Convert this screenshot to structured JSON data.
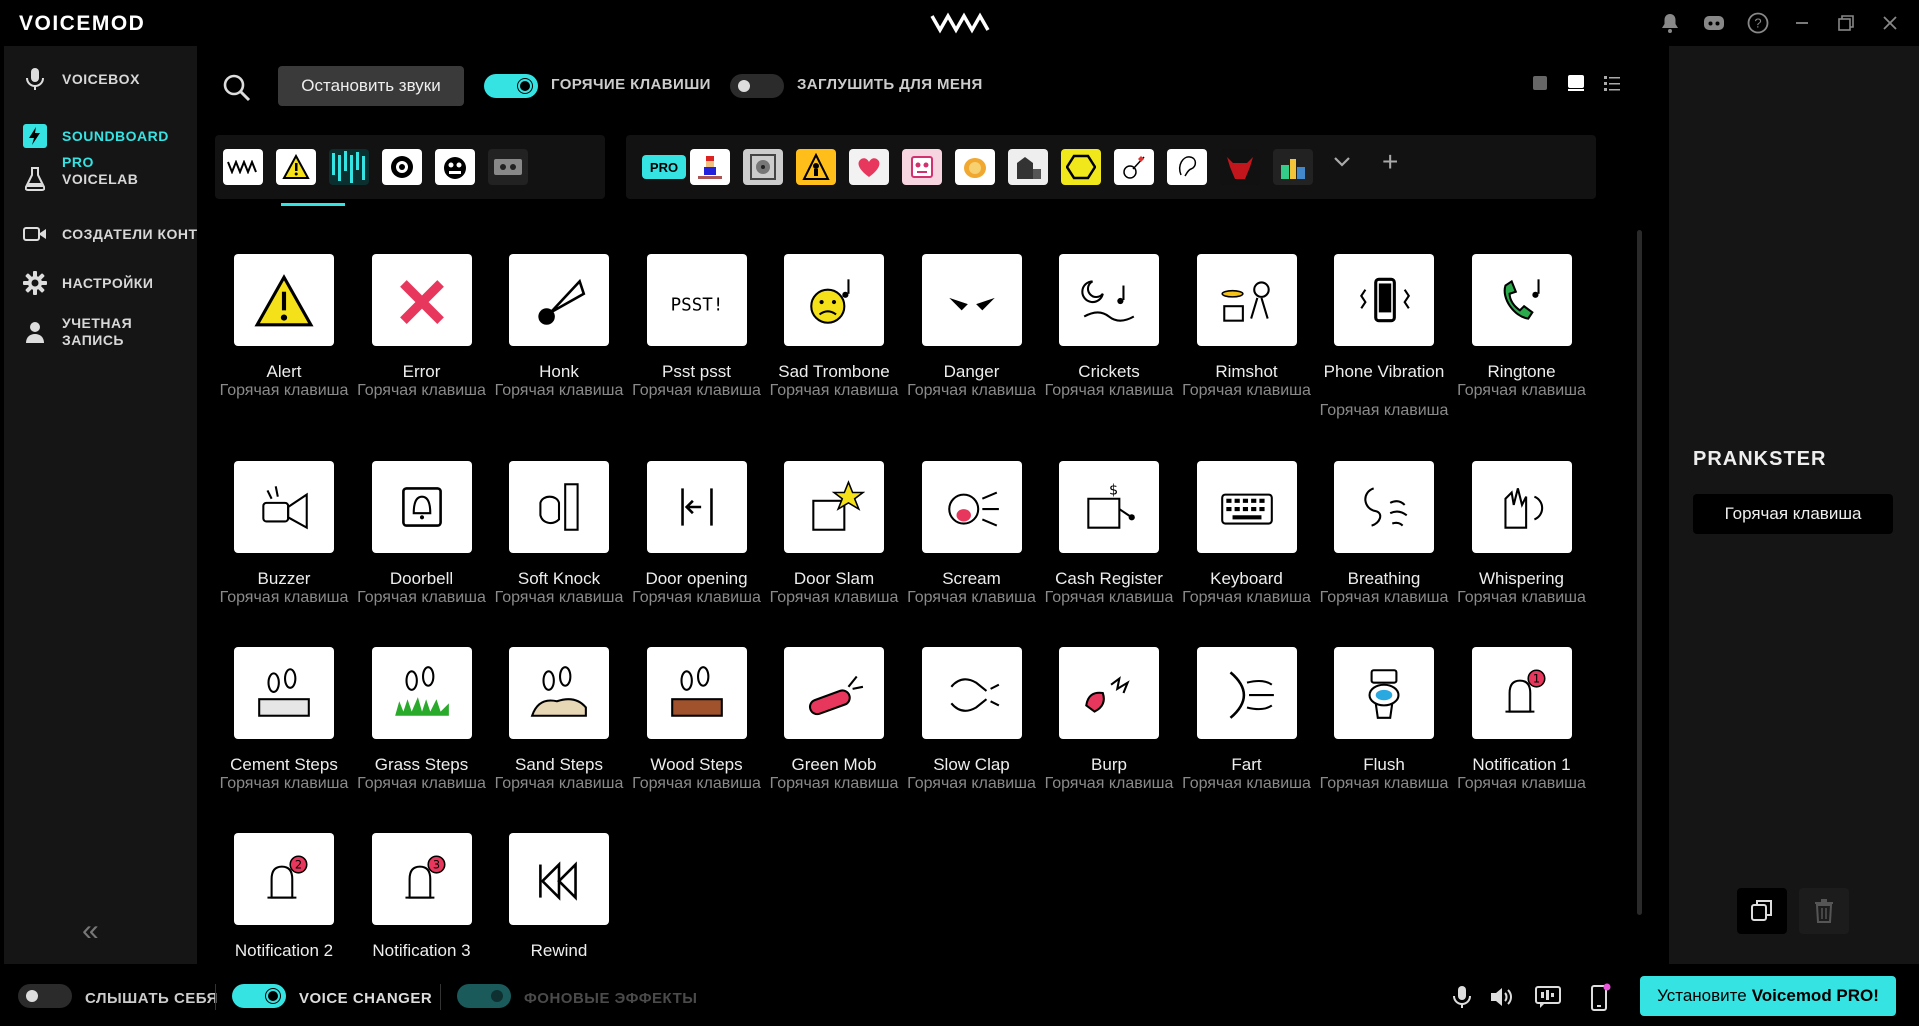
{
  "app": {
    "brand": "VOICEMOD"
  },
  "colors": {
    "accent": "#36e3e3",
    "background": "#000000",
    "panel": "#151515"
  },
  "sidebar": {
    "items": [
      {
        "label": "VOICEBOX",
        "icon": "microphone-icon"
      },
      {
        "label": "SOUNDBOARD",
        "icon": "lightning-icon",
        "active": true
      },
      {
        "pro": "PRO",
        "label": "VOICELAB",
        "icon": "flask-icon"
      },
      {
        "label": "СОЗДАТЕЛИ КОНТЕНТА",
        "icon": "camera-icon"
      },
      {
        "label": "НАСТРОЙКИ",
        "icon": "gear-icon"
      },
      {
        "label": "УЧЕТНАЯ\nЗАПИСЬ",
        "label1": "УЧЕТНАЯ",
        "label2": "ЗАПИСЬ",
        "icon": "user-icon"
      }
    ],
    "collapse": "«"
  },
  "toolbar": {
    "stop_sounds": "Остановить звуки",
    "hotkeys": "ГОРЯЧИЕ КЛАВИШИ",
    "mute_for_me": "ЗАГЛУШИТЬ ДЛЯ МЕНЯ"
  },
  "categories": {
    "pro": "PRO",
    "plus": "+",
    "more": "⌄"
  },
  "sounds": [
    {
      "name": "Alert",
      "hotkey": "Горячая клавиша"
    },
    {
      "name": "Error",
      "hotkey": "Горячая клавиша"
    },
    {
      "name": "Honk",
      "hotkey": "Горячая клавиша"
    },
    {
      "name": "Psst psst",
      "hotkey": "Горячая клавиша"
    },
    {
      "name": "Sad Trombone",
      "hotkey": "Горячая клавиша"
    },
    {
      "name": "Danger",
      "hotkey": "Горячая клавиша"
    },
    {
      "name": "Crickets",
      "hotkey": "Горячая клавиша"
    },
    {
      "name": "Rimshot",
      "hotkey": "Горячая клавиша"
    },
    {
      "name": "Phone Vibration",
      "hotkey": "Горячая клавиша"
    },
    {
      "name": "Ringtone",
      "hotkey": "Горячая клавиша"
    },
    {
      "name": "Buzzer",
      "hotkey": "Горячая клавиша"
    },
    {
      "name": "Doorbell",
      "hotkey": "Горячая клавиша"
    },
    {
      "name": "Soft Knock",
      "hotkey": "Горячая клавиша"
    },
    {
      "name": "Door opening",
      "hotkey": "Горячая клавиша"
    },
    {
      "name": "Door Slam",
      "hotkey": "Горячая клавиша"
    },
    {
      "name": "Scream",
      "hotkey": "Горячая клавиша"
    },
    {
      "name": "Cash Register",
      "hotkey": "Горячая клавиша"
    },
    {
      "name": "Keyboard",
      "hotkey": "Горячая клавиша"
    },
    {
      "name": "Breathing",
      "hotkey": "Горячая клавиша"
    },
    {
      "name": "Whispering",
      "hotkey": "Горячая клавиша"
    },
    {
      "name": "Cement Steps",
      "hotkey": "Горячая клавиша"
    },
    {
      "name": "Grass Steps",
      "hotkey": "Горячая клавиша"
    },
    {
      "name": "Sand Steps",
      "hotkey": "Горячая клавиша"
    },
    {
      "name": "Wood Steps",
      "hotkey": "Горячая клавиша"
    },
    {
      "name": "Green Mob",
      "hotkey": "Горячая клавиша"
    },
    {
      "name": "Slow Clap",
      "hotkey": "Горячая клавиша"
    },
    {
      "name": "Burp",
      "hotkey": "Горячая клавиша"
    },
    {
      "name": "Fart",
      "hotkey": "Горячая клавиша"
    },
    {
      "name": "Flush",
      "hotkey": "Горячая клавиша"
    },
    {
      "name": "Notification 1",
      "hotkey": "Горячая клавиша"
    },
    {
      "name": "Notification 2",
      "hotkey": ""
    },
    {
      "name": "Notification 3",
      "hotkey": ""
    },
    {
      "name": "Rewind",
      "hotkey": ""
    }
  ],
  "right_panel": {
    "title": "PRANKSTER",
    "hotkey_button": "Горячая клавиша"
  },
  "bottom": {
    "hear_myself": "СЛЫШАТЬ СЕБЯ",
    "voice_changer": "VOICE CHANGER",
    "background_effects": "ФОНОВЫЕ ЭФФЕКТЫ",
    "pro_cta_prefix": "Установите",
    "pro_cta_brand": "Voicemod PRO!"
  }
}
